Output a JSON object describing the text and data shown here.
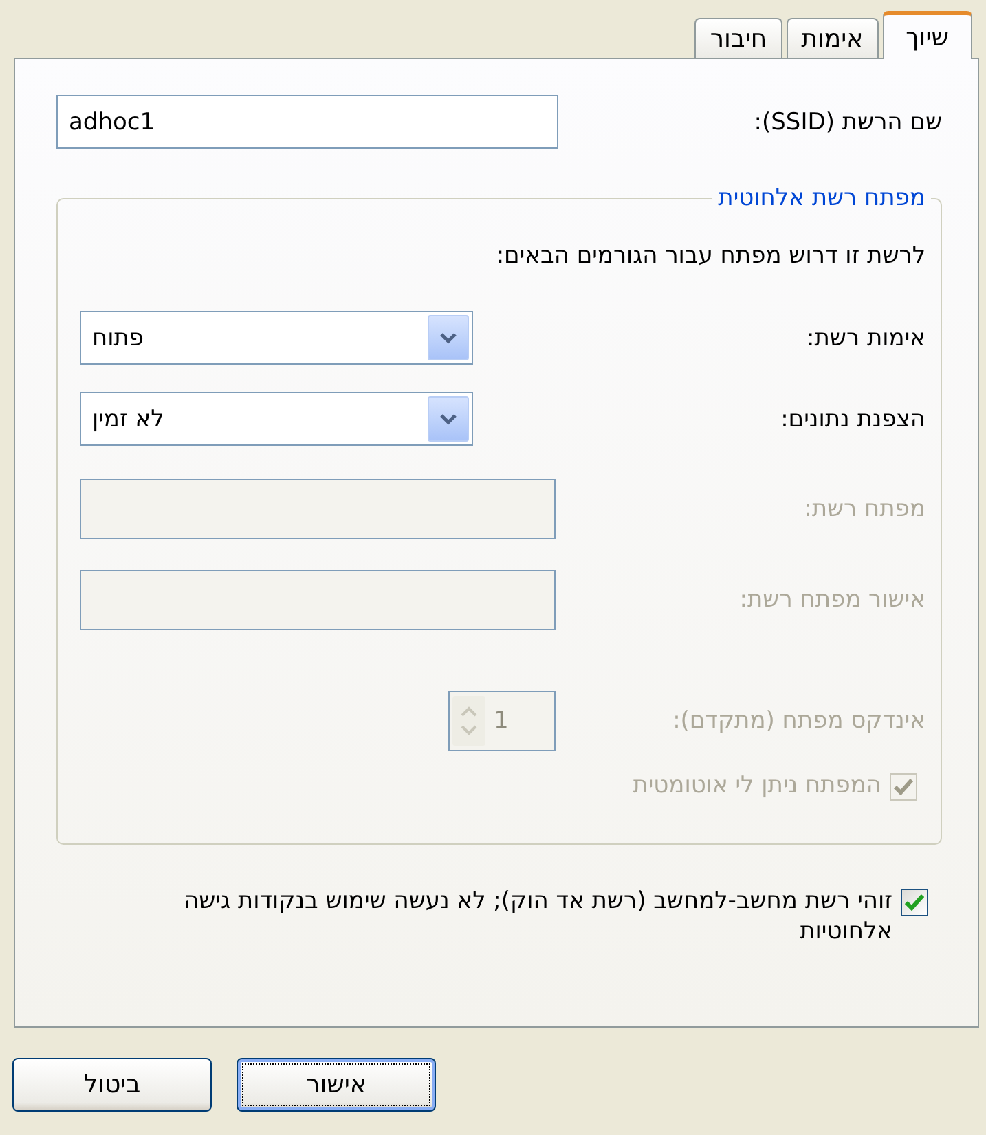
{
  "tabs": [
    {
      "label": "שיוך",
      "selected": true
    },
    {
      "label": "אימות",
      "selected": false
    },
    {
      "label": "חיבור",
      "selected": false
    }
  ],
  "ssid": {
    "label": "שם הרשת (SSID):",
    "value": "adhoc1"
  },
  "key_group": {
    "title": "מפתח רשת אלחוטית",
    "intro": "לרשת זו דרוש מפתח עבור הגורמים הבאים:",
    "fields": [
      {
        "kind": "combo",
        "label": "אימות רשת:",
        "value": "פתוח",
        "disabled": false
      },
      {
        "kind": "combo",
        "label": "הצפנת נתונים:",
        "value": "לא זמין",
        "disabled": false
      },
      {
        "kind": "text",
        "label": "מפתח רשת:",
        "disabled": true
      },
      {
        "kind": "text",
        "label": "אישור מפתח רשת:",
        "disabled": true
      },
      {
        "kind": "spin",
        "label": "אינדקס מפתח (מתקדם):",
        "value": "1",
        "disabled": true
      },
      {
        "kind": "check",
        "label": "המפתח ניתן לי אוטומטית",
        "checked": true,
        "disabled": true
      }
    ]
  },
  "adhoc": {
    "label": "זוהי רשת מחשב-למחשב (רשת אד הוק); לא נעשה שימוש בנקודות גישה אלחוטיות",
    "checked": true
  },
  "buttons": [
    {
      "label": "אישור",
      "default": true
    },
    {
      "label": "ביטול",
      "default": false
    }
  ]
}
